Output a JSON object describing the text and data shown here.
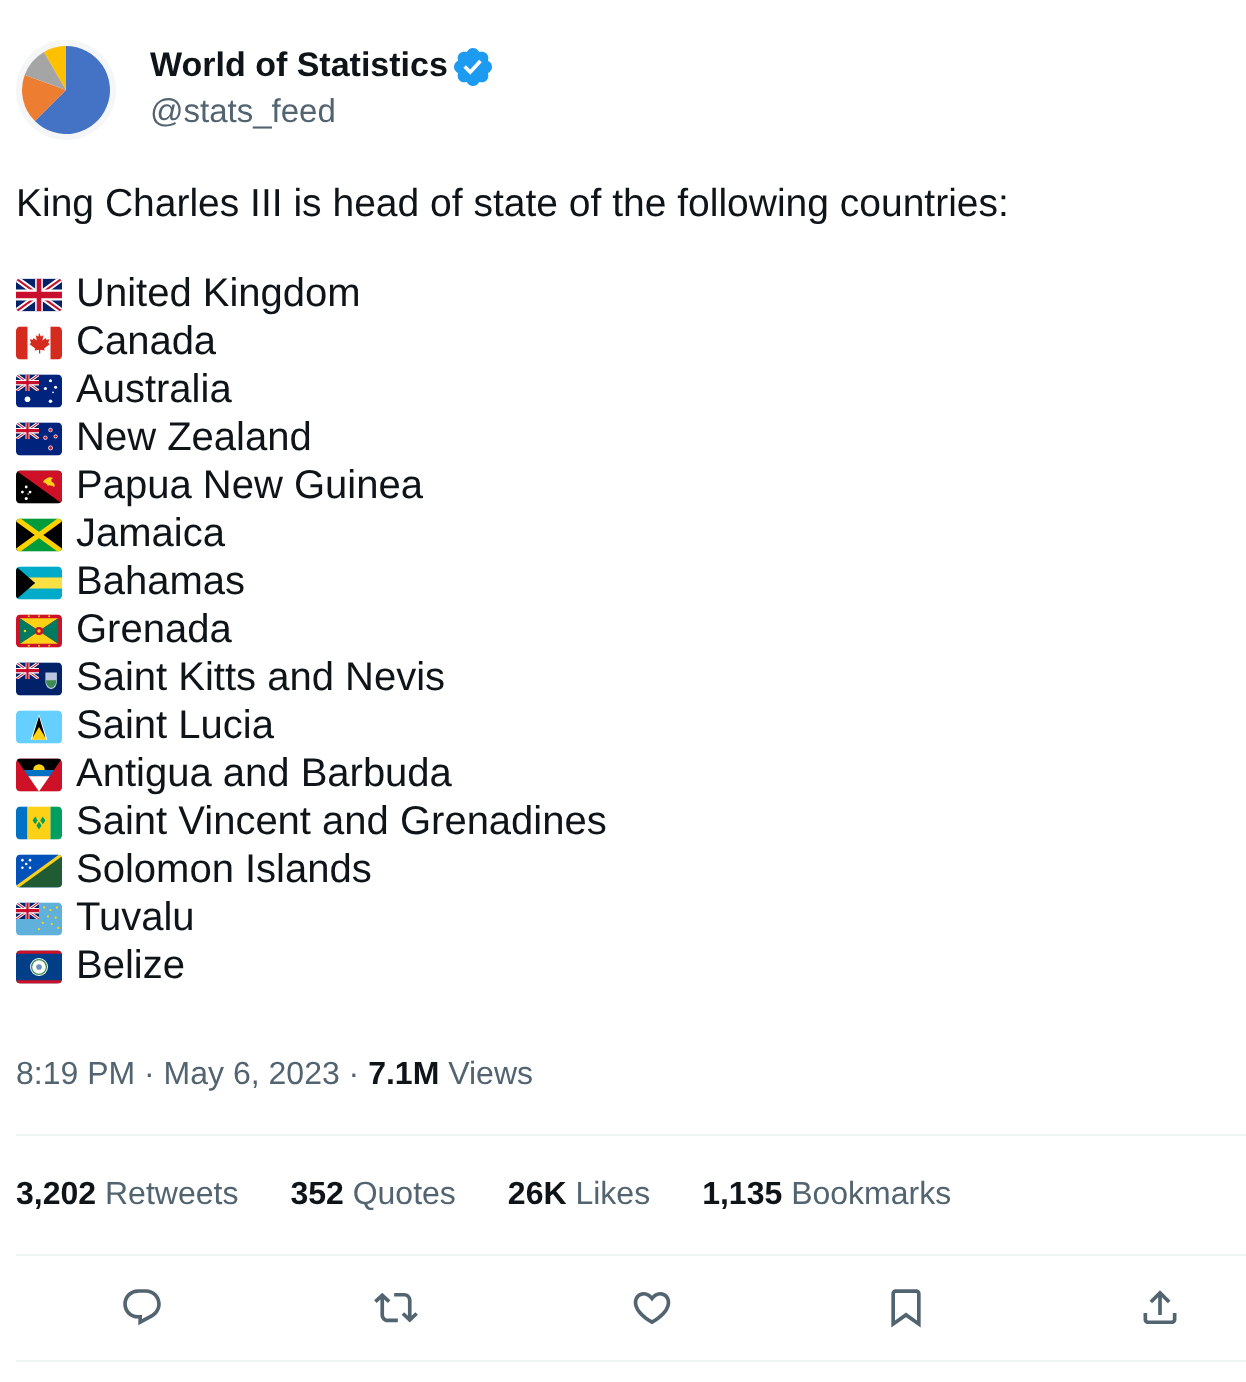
{
  "author": {
    "name": "World of Statistics",
    "handle": "@stats_feed",
    "verified": true
  },
  "intro": "King Charles III is head of state of the following countries:",
  "countries": [
    {
      "kind": "gb",
      "name": "United Kingdom"
    },
    {
      "kind": "ca",
      "name": "Canada"
    },
    {
      "kind": "au",
      "name": "Australia"
    },
    {
      "kind": "nz",
      "name": "New Zealand"
    },
    {
      "kind": "pg",
      "name": "Papua New Guinea"
    },
    {
      "kind": "jm",
      "name": "Jamaica"
    },
    {
      "kind": "bs",
      "name": "Bahamas"
    },
    {
      "kind": "gd",
      "name": "Grenada"
    },
    {
      "kind": "ensign",
      "name": "Saint Kitts and Nevis"
    },
    {
      "kind": "lc",
      "name": "Saint Lucia"
    },
    {
      "kind": "ag",
      "name": "Antigua and Barbuda"
    },
    {
      "kind": "vc",
      "name": "Saint Vincent and Grenadines"
    },
    {
      "kind": "sb",
      "name": "Solomon Islands"
    },
    {
      "kind": "tv",
      "name": "Tuvalu"
    },
    {
      "kind": "bz",
      "name": "Belize"
    }
  ],
  "meta": "8:19 PM · May 6, 2023 · **7.1M** Views",
  "stats": [
    "**3,202** Retweets",
    "**352** Quotes",
    "**26K** Likes",
    "**1,135** Bookmarks"
  ]
}
